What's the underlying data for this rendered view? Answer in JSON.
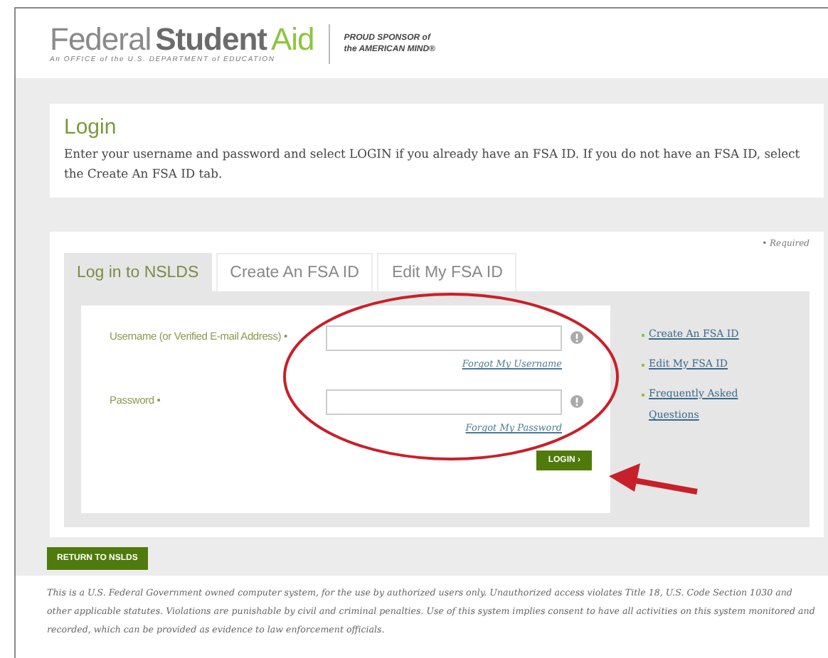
{
  "header": {
    "logo": {
      "light": "Federal",
      "bold": "Student",
      "accent": "Aid",
      "tagline": "An OFFICE of the U.S. DEPARTMENT of EDUCATION"
    },
    "sponsor": [
      "PROUD SPONSOR of",
      "the AMERICAN MIND®"
    ]
  },
  "intro": {
    "title": "Login",
    "text": "Enter your username and password and select LOGIN if you already have an FSA ID. If you do not have an FSA ID, select the Create An FSA ID tab."
  },
  "required_note": "• Required",
  "tabs": [
    {
      "label": "Log in to NSLDS",
      "selected": true
    },
    {
      "label": "Create An FSA ID",
      "selected": false
    },
    {
      "label": "Edit My FSA ID",
      "selected": false
    }
  ],
  "fields": [
    {
      "label": "Username (or Verified E-mail Address) •",
      "link": "Forgot My Username"
    },
    {
      "label": "Password •",
      "link": "Forgot My Password"
    }
  ],
  "login_button": "LOGIN ›",
  "side_links": [
    "Create An FSA ID",
    "Edit My FSA ID",
    "Frequently Asked Questions"
  ],
  "return_button": "RETURN TO NSLDS",
  "disclaimer": "This is a U.S. Federal Government owned computer system, for the use by authorized users only. Unauthorized access violates Title 18, U.S. Code Section 1030 and other applicable statutes. Violations are punishable by civil and criminal penalties. Use of this system implies consent to have all activities on this system monitored and recorded, which can be provided as evidence to law enforcement officials."
}
